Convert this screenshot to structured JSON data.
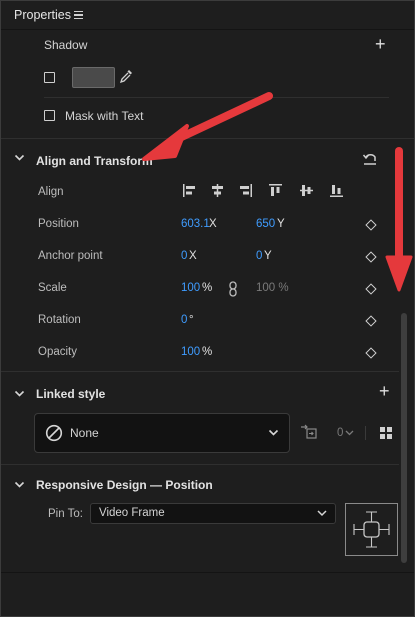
{
  "panel": {
    "title": "Properties",
    "menu_icon": "hamburger-icon"
  },
  "shadow": {
    "label": "Shadow",
    "add_icon": "plus-icon",
    "enabled": false,
    "color_swatch": "#4a4a4a",
    "eyedropper_icon": "eyedropper-icon"
  },
  "mask": {
    "label": "Mask with Text",
    "checked": false
  },
  "align_transform": {
    "title": "Align and Transform",
    "reset_icon": "reset-icon",
    "align_label": "Align",
    "align_icons": [
      "align-left-icon",
      "align-center-horizontal-icon",
      "align-right-icon",
      "align-top-icon",
      "align-center-vertical-icon",
      "align-bottom-icon"
    ],
    "position": {
      "label": "Position",
      "x_value": "603.1",
      "x_unit": "X",
      "y_value": "650",
      "y_unit": "Y"
    },
    "anchor": {
      "label": "Anchor point",
      "x_value": "0",
      "x_unit": "X",
      "y_value": "0",
      "y_unit": "Y"
    },
    "scale": {
      "label": "Scale",
      "value": "100",
      "unit": "%",
      "linked_value": "100 %"
    },
    "rotation": {
      "label": "Rotation",
      "value": "0",
      "unit": "°"
    },
    "opacity": {
      "label": "Opacity",
      "value": "100",
      "unit": "%"
    }
  },
  "linked_style": {
    "title": "Linked style",
    "selected": "None",
    "count": "0"
  },
  "responsive": {
    "title": "Responsive Design — Position",
    "pin_label": "Pin To:",
    "pin_value": "Video Frame"
  },
  "annotations": {
    "arrow_color": "#e5393c"
  }
}
